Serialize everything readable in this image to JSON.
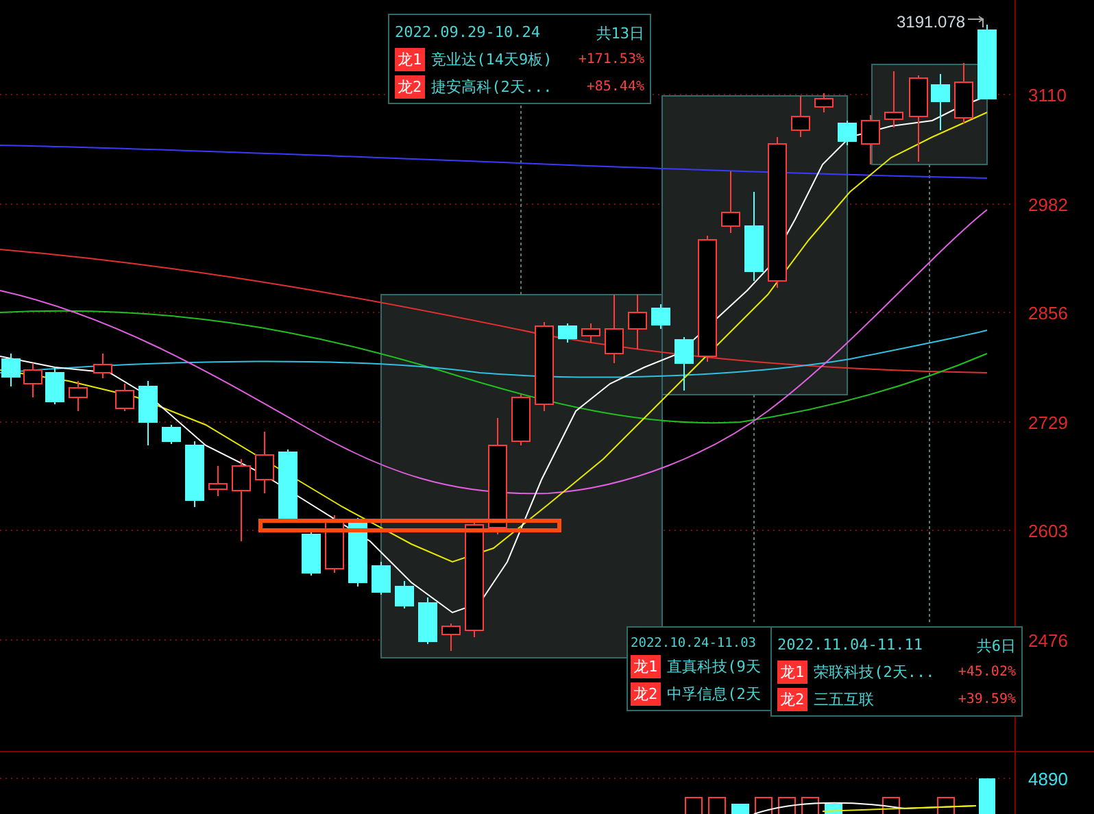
{
  "price_axis": {
    "labels": [
      "3110",
      "2982",
      "2856",
      "2729",
      "2603",
      "2476"
    ]
  },
  "last_price": "3191.078",
  "volume_axis": {
    "label": "4890"
  },
  "tooltips": [
    {
      "date_range": "2022.09.29-10.24",
      "total_days": "共13日",
      "items": [
        {
          "badge": "龙1",
          "name": "竞业达(14天9板)",
          "change": "+171.53%"
        },
        {
          "badge": "龙2",
          "name": "捷安高科(2天...",
          "change": "+85.44%"
        }
      ]
    },
    {
      "date_range": "2022.10.24-11.03",
      "items": [
        {
          "badge": "龙1",
          "name": "直真科技(9天"
        },
        {
          "badge": "龙2",
          "name": "中孚信息(2天"
        }
      ]
    },
    {
      "date_range": "2022.11.04-11.11",
      "total_days": "共6日",
      "items": [
        {
          "badge": "龙1",
          "name": "荣联科技(2天...",
          "change": "+45.02%"
        },
        {
          "badge": "龙2",
          "name": "三五互联",
          "change": "+39.59%"
        }
      ]
    }
  ]
}
